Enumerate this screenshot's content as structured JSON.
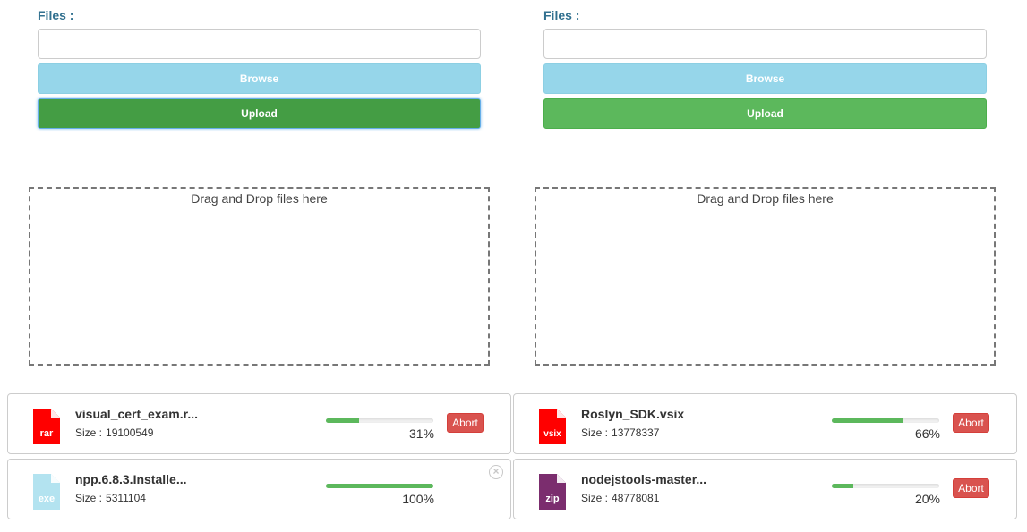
{
  "uploaders": [
    {
      "files_label": "Files :",
      "browse_label": "Browse",
      "upload_label": "Upload",
      "dropzone_text": "Drag and Drop files here"
    },
    {
      "files_label": "Files :",
      "browse_label": "Browse",
      "upload_label": "Upload",
      "dropzone_text": "Drag and Drop files here"
    }
  ],
  "files": [
    {
      "ext": "rar",
      "icon_color": "#ff0000",
      "name": "visual_cert_exam.r...",
      "size_label": "Size :",
      "size": "19100549",
      "progress": 31,
      "percent_text": "31%",
      "abort_label": "Abort"
    },
    {
      "ext": "vsix",
      "icon_color": "#ff0000",
      "name": "Roslyn_SDK.vsix",
      "size_label": "Size :",
      "size": "13778337",
      "progress": 66,
      "percent_text": "66%",
      "abort_label": "Abort"
    },
    {
      "ext": "exe",
      "icon_color": "#b3e3f0",
      "name": "npp.6.8.3.Installe...",
      "size_label": "Size :",
      "size": "5311104",
      "progress": 100,
      "percent_text": "100%"
    },
    {
      "ext": "zip",
      "icon_color": "#7b2d6e",
      "name": "nodejstools-master...",
      "size_label": "Size :",
      "size": "48778081",
      "progress": 20,
      "percent_text": "20%",
      "abort_label": "Abort"
    }
  ],
  "colors": {
    "progress": "#5cb85c",
    "abort": "#d9534f",
    "label": "#31708f"
  }
}
